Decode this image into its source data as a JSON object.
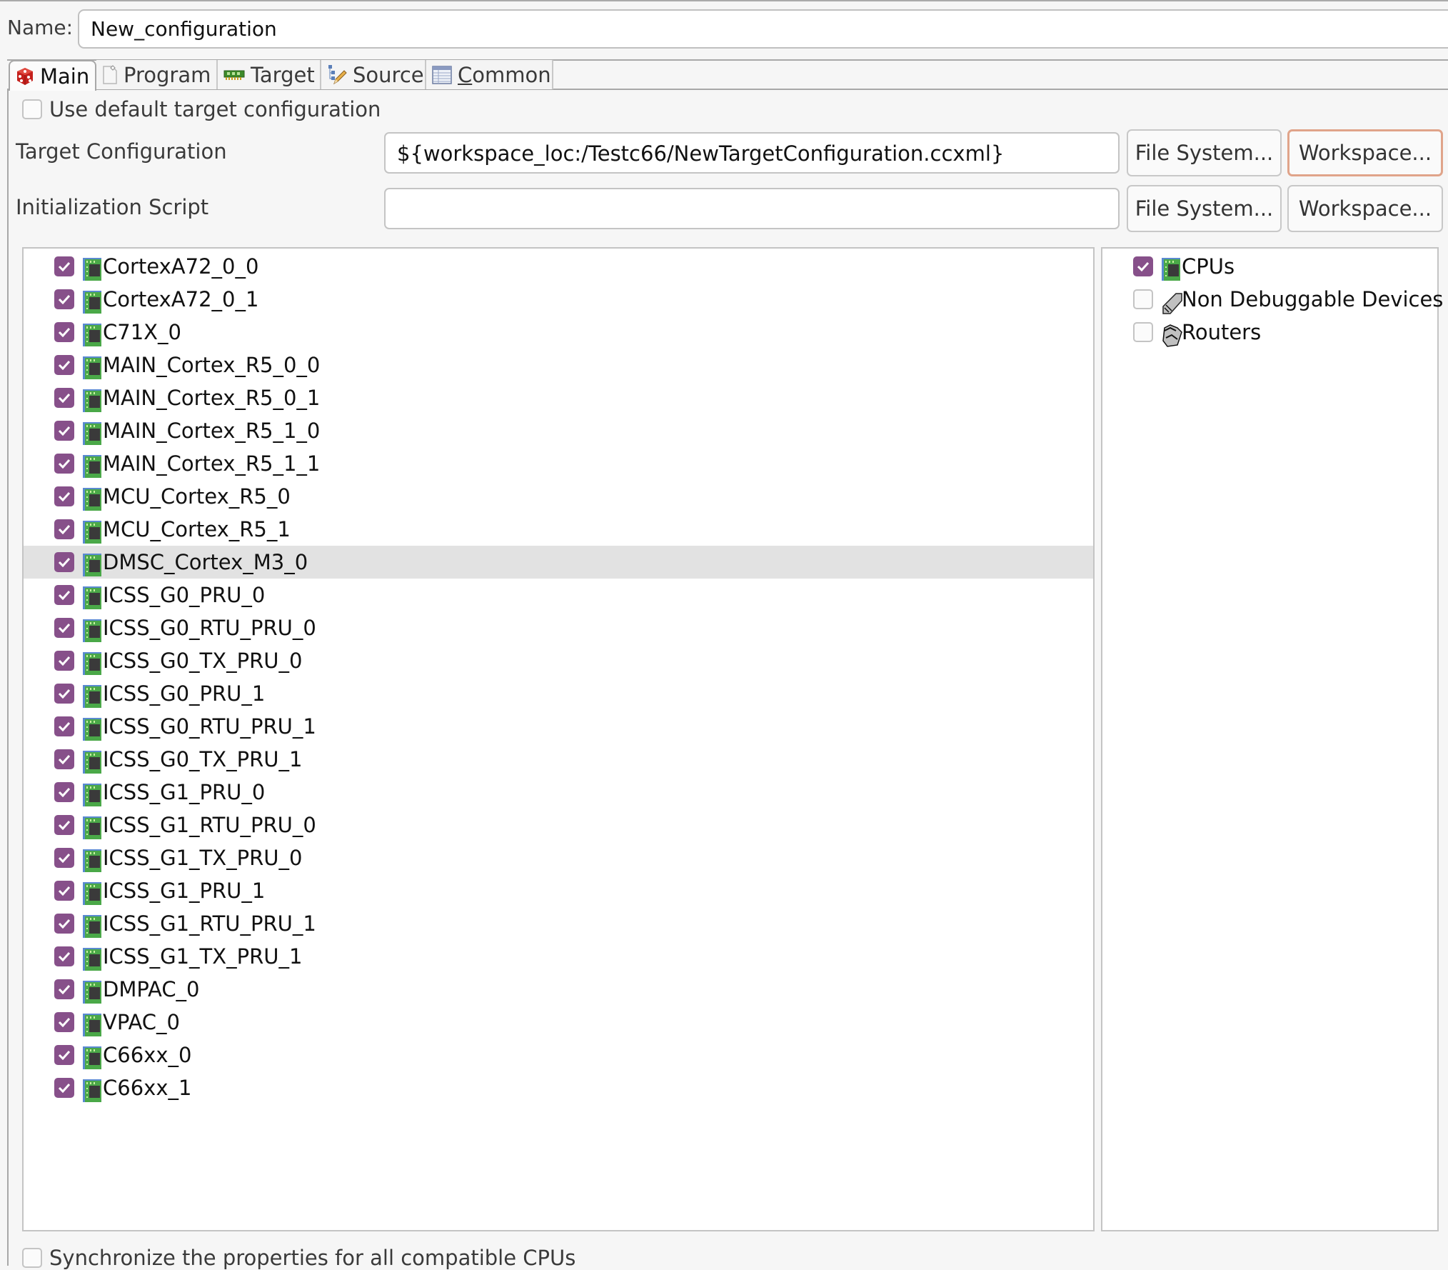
{
  "config": {
    "name_label": "Name:",
    "name_value": "New_configuration"
  },
  "tabs": [
    {
      "label": "Main",
      "icon": "main-tab-icon",
      "active": true
    },
    {
      "label": "Program",
      "icon": "program-tab-icon",
      "active": false
    },
    {
      "label": "Target",
      "icon": "target-tab-icon",
      "active": false
    },
    {
      "label": "Source",
      "icon": "source-tab-icon",
      "active": false
    },
    {
      "label_prefix": "C",
      "label_rest": "ommon",
      "label": "Common",
      "icon": "common-tab-icon",
      "active": false
    }
  ],
  "main": {
    "use_default_label": "Use default target configuration",
    "use_default_checked": false,
    "target_config": {
      "label": "Target Configuration",
      "value": "${workspace_loc:/Testc66/NewTargetConfiguration.ccxml}",
      "file_system_button": "File System...",
      "workspace_button": "Workspace..."
    },
    "init_script": {
      "label": "Initialization Script",
      "value": "",
      "file_system_button": "File System...",
      "workspace_button": "Workspace..."
    },
    "cores": [
      {
        "label": "CortexA72_0_0",
        "checked": true
      },
      {
        "label": "CortexA72_0_1",
        "checked": true
      },
      {
        "label": "C71X_0",
        "checked": true
      },
      {
        "label": "MAIN_Cortex_R5_0_0",
        "checked": true
      },
      {
        "label": "MAIN_Cortex_R5_0_1",
        "checked": true
      },
      {
        "label": "MAIN_Cortex_R5_1_0",
        "checked": true
      },
      {
        "label": "MAIN_Cortex_R5_1_1",
        "checked": true
      },
      {
        "label": "MCU_Cortex_R5_0",
        "checked": true
      },
      {
        "label": "MCU_Cortex_R5_1",
        "checked": true
      },
      {
        "label": "DMSC_Cortex_M3_0",
        "checked": true,
        "selected": true
      },
      {
        "label": "ICSS_G0_PRU_0",
        "checked": true
      },
      {
        "label": "ICSS_G0_RTU_PRU_0",
        "checked": true
      },
      {
        "label": "ICSS_G0_TX_PRU_0",
        "checked": true
      },
      {
        "label": "ICSS_G0_PRU_1",
        "checked": true
      },
      {
        "label": "ICSS_G0_RTU_PRU_1",
        "checked": true
      },
      {
        "label": "ICSS_G0_TX_PRU_1",
        "checked": true
      },
      {
        "label": "ICSS_G1_PRU_0",
        "checked": true
      },
      {
        "label": "ICSS_G1_RTU_PRU_0",
        "checked": true
      },
      {
        "label": "ICSS_G1_TX_PRU_0",
        "checked": true
      },
      {
        "label": "ICSS_G1_PRU_1",
        "checked": true
      },
      {
        "label": "ICSS_G1_RTU_PRU_1",
        "checked": true
      },
      {
        "label": "ICSS_G1_TX_PRU_1",
        "checked": true
      },
      {
        "label": "DMPAC_0",
        "checked": true
      },
      {
        "label": "VPAC_0",
        "checked": true
      },
      {
        "label": "C66xx_0",
        "checked": true
      },
      {
        "label": "C66xx_1",
        "checked": true
      }
    ],
    "filters": [
      {
        "label": "CPUs",
        "checked": true,
        "icon": "cpu-chip-icon"
      },
      {
        "label": "Non Debuggable Devices",
        "checked": false,
        "icon": "non-debuggable-device-icon"
      },
      {
        "label": "Routers",
        "checked": false,
        "icon": "router-icon"
      }
    ],
    "sync_label": "Synchronize the properties for all compatible CPUs",
    "sync_checked": false
  },
  "colors": {
    "checkbox_checked": "#87508a",
    "focus_border": "#e0a48a",
    "selected_row": "#e2e2e2"
  }
}
